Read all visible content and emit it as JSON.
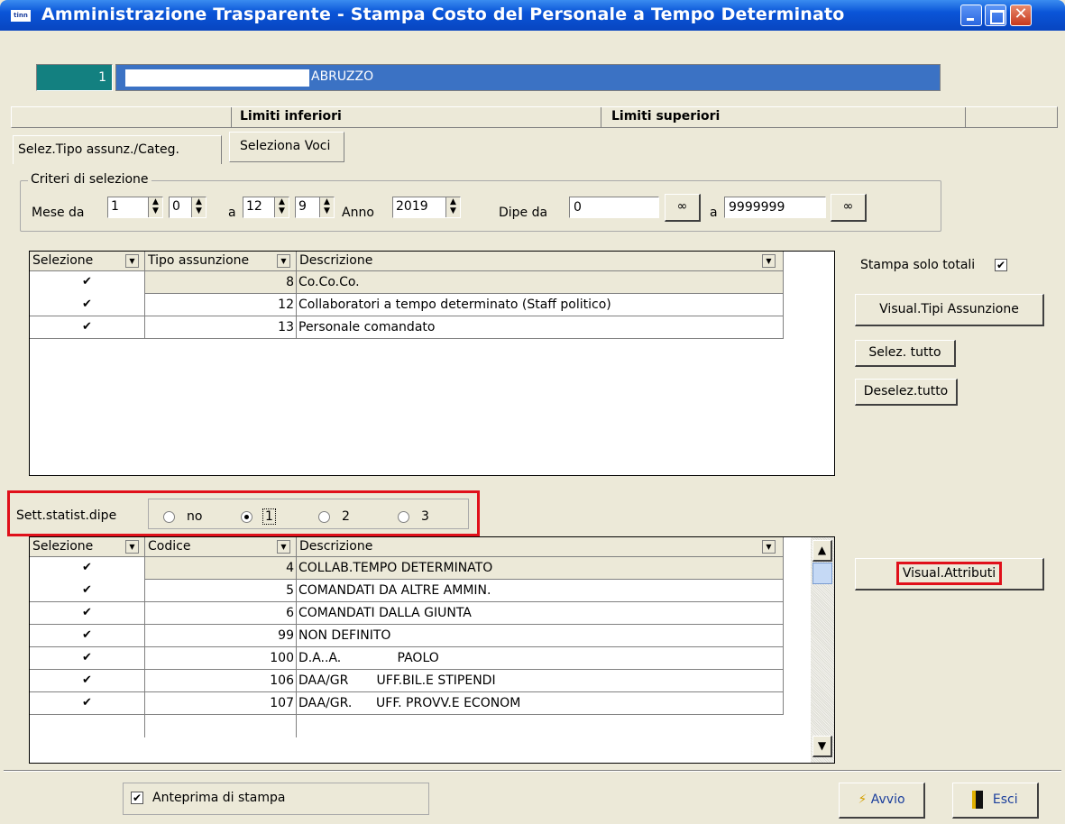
{
  "window": {
    "title": "Amministrazione Trasparente - Stampa Costo del Personale a Tempo Determinato",
    "icon_text": "tinn"
  },
  "entity": {
    "code": "1",
    "name": "ABRUZZO"
  },
  "limits": {
    "lower": "Limiti inferiori",
    "upper": "Limiti superiori"
  },
  "tabs": [
    {
      "label": "Selez.Tipo assunz./Categ."
    },
    {
      "label": "Seleziona Voci"
    }
  ],
  "criteria": {
    "group_label": "Criteri di selezione",
    "mese_da_label": "Mese da",
    "mese_da_1": "1",
    "mese_da_2": "0",
    "a_label": "a",
    "mese_a_1": "12",
    "mese_a_2": "9",
    "anno_label": "Anno",
    "anno": "2019",
    "dipe_da_label": "Dipe da",
    "dipe_da": "0",
    "dipe_a_label": "a",
    "dipe_a": "9999999"
  },
  "grid1": {
    "headers": [
      "Selezione",
      "Tipo assunzione",
      "Descrizione"
    ],
    "rows": [
      {
        "checked": "✔",
        "code": "8",
        "desc": "Co.Co.Co."
      },
      {
        "checked": "✔",
        "code": "12",
        "desc": "Collaboratori a tempo determinato (Staff politico)"
      },
      {
        "checked": "✔",
        "code": "13",
        "desc": "Personale comandato"
      }
    ]
  },
  "right_panel": {
    "stampa_solo_totali": "Stampa solo totali",
    "stampa_checked": "✔",
    "visual_tipi": "Visual.Tipi Assunzione",
    "selez_tutto": "Selez. tutto",
    "deselez_tutto": "Deselez.tutto",
    "visual_attributi": "Visual.Attributi"
  },
  "sett": {
    "label": "Sett.statist.dipe",
    "options": [
      "no",
      "1",
      "2",
      "3"
    ],
    "selected": "1"
  },
  "grid2": {
    "headers": [
      "Selezione",
      "Codice",
      "Descrizione"
    ],
    "rows": [
      {
        "checked": "✔",
        "code": "4",
        "desc": "COLLAB.TEMPO DETERMINATO"
      },
      {
        "checked": "✔",
        "code": "5",
        "desc": "COMANDATI DA ALTRE AMMIN."
      },
      {
        "checked": "✔",
        "code": "6",
        "desc": "COMANDATI DALLA GIUNTA"
      },
      {
        "checked": "✔",
        "code": "99",
        "desc": "NON DEFINITO"
      },
      {
        "checked": "✔",
        "code": "100",
        "desc": "D.A..A.              PAOLO"
      },
      {
        "checked": "✔",
        "code": "106",
        "desc": "DAA/GR       UFF.BIL.E STIPENDI"
      },
      {
        "checked": "✔",
        "code": "107",
        "desc": "DAA/GR.      UFF. PROVV.E ECONOM"
      }
    ]
  },
  "footer": {
    "anteprima": "Anteprima di stampa",
    "anteprima_checked": "✔",
    "avvio": "Avvio",
    "esci": "Esci"
  }
}
